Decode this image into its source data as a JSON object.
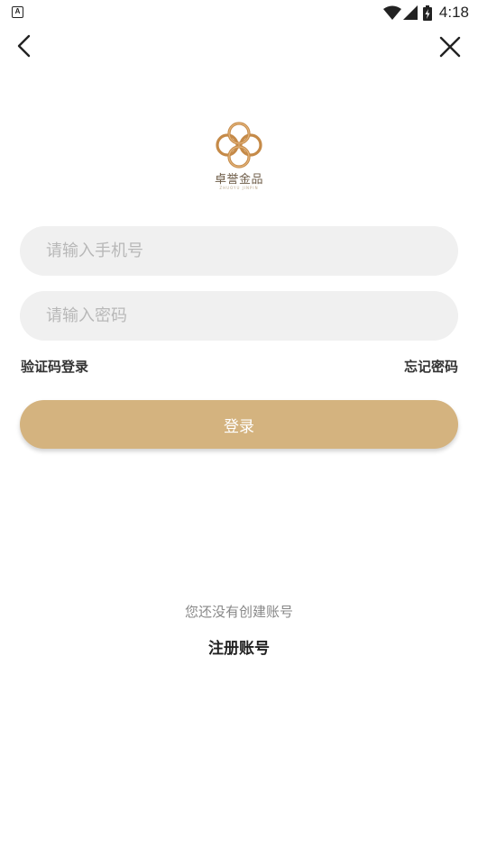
{
  "status_bar": {
    "app_icon_glyph": "A",
    "time": "4:18",
    "icons": [
      "notification-icon",
      "wifi-icon",
      "signal-icon",
      "battery-charging-icon"
    ]
  },
  "nav": {
    "back_icon": "chevron-left-icon",
    "close_icon": "close-icon"
  },
  "logo": {
    "name": "卓誉金品",
    "subtitle": "ZHUOYU JINPIN",
    "color": "#c58a48"
  },
  "form": {
    "phone_placeholder": "请输入手机号",
    "phone_value": "",
    "password_placeholder": "请输入密码",
    "password_value": "",
    "sms_login_label": "验证码登录",
    "forgot_password_label": "忘记密码",
    "login_label": "登录"
  },
  "footer": {
    "no_account_text": "您还没有创建账号",
    "register_label": "注册账号"
  },
  "colors": {
    "accent": "#d4b37f",
    "input_bg": "#f0f0f0",
    "placeholder": "#b8b8b8"
  }
}
